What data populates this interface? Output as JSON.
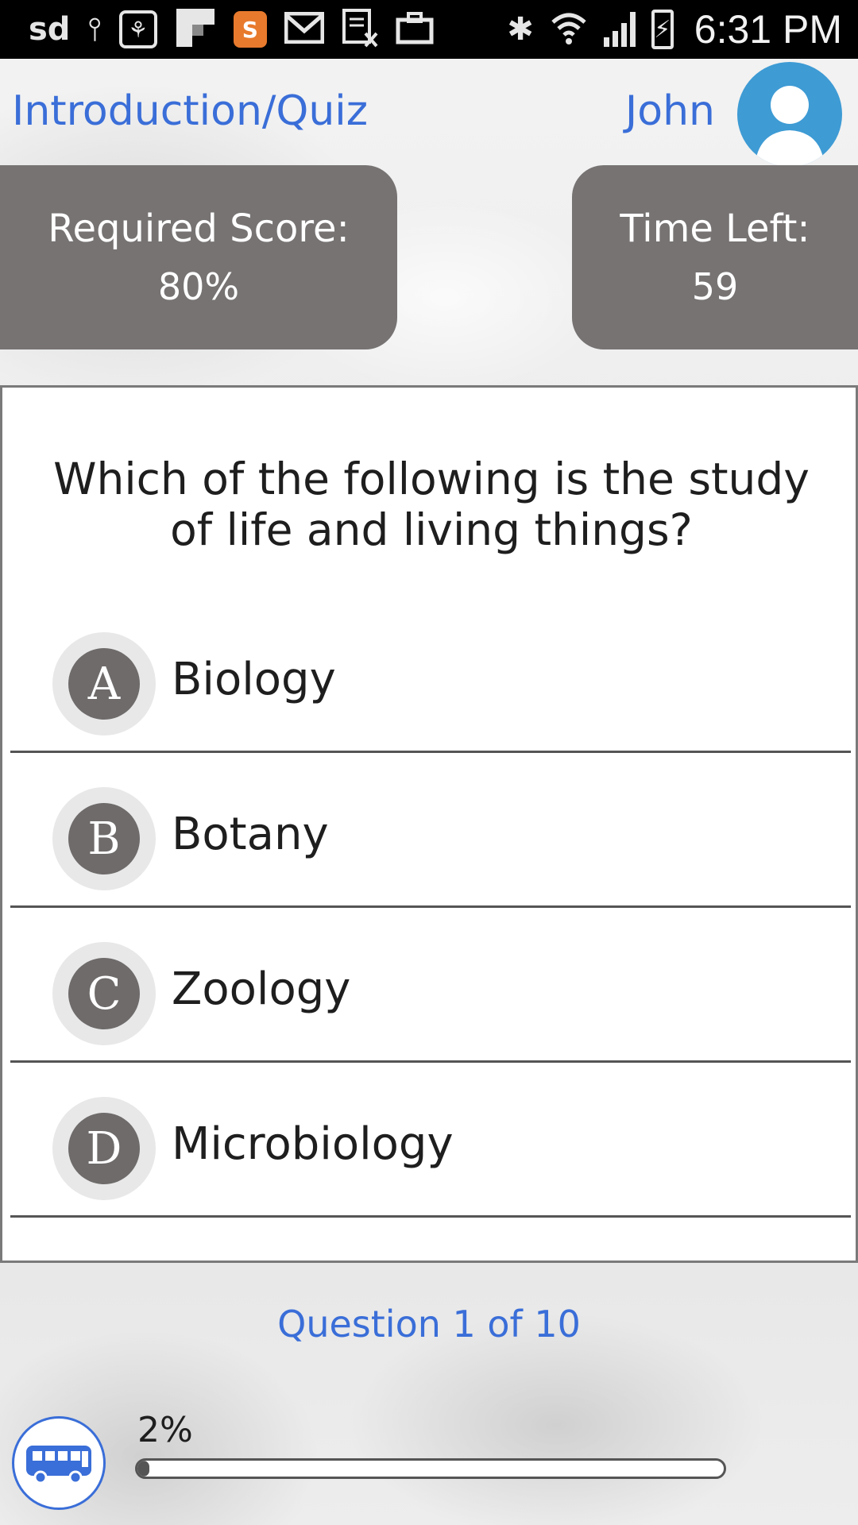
{
  "status_bar": {
    "left_icons": [
      "sd-card-icon",
      "usb-icon",
      "app-icon",
      "gallery-icon",
      "s-app-icon",
      "gmail-icon",
      "calendar-icon",
      "briefcase-icon"
    ],
    "sd_label": "sd",
    "time": "6:31 PM"
  },
  "header": {
    "title": "Introduction/Quiz",
    "user_name": "John"
  },
  "info": {
    "required_score_label": "Required Score:",
    "required_score_value": "80%",
    "time_left_label": "Time Left:",
    "time_left_value": "59"
  },
  "quiz": {
    "question": "Which of the following is the study of life and living things?",
    "options": [
      {
        "letter": "A",
        "label": "Biology"
      },
      {
        "letter": "B",
        "label": "Botany"
      },
      {
        "letter": "C",
        "label": "Zoology"
      },
      {
        "letter": "D",
        "label": "Microbiology"
      }
    ]
  },
  "footer": {
    "question_counter": "Question 1 of 10",
    "progress_label": "2%",
    "progress_fraction": 0.02
  },
  "colors": {
    "accent": "#3a6ed8",
    "box_gray": "#777373",
    "avatar_blue": "#3e9bd4"
  }
}
